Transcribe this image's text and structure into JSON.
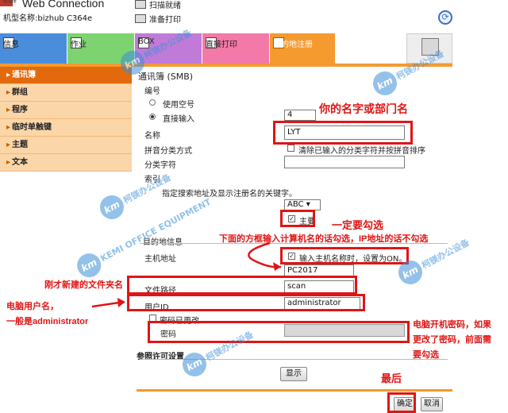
{
  "header": {
    "logo_text": "SCOPE",
    "title": "Web Connection",
    "model_name": "机型名称:bizhub C364e",
    "status_scan": "扫描就绪",
    "status_print": "准备打印"
  },
  "tabs": [
    {
      "label": "信息"
    },
    {
      "label": "作业"
    },
    {
      "label": "BOX"
    },
    {
      "label": "直接打印"
    },
    {
      "label": "目的地注册"
    }
  ],
  "sidebar": {
    "items": [
      {
        "label": "通讯簿"
      },
      {
        "label": "群组"
      },
      {
        "label": "程序"
      },
      {
        "label": "临时单触键"
      },
      {
        "label": "主题"
      },
      {
        "label": "文本"
      }
    ]
  },
  "form": {
    "heading": "通讯簿 (SMB)",
    "number_label": "编号",
    "use_free_number": "使用空号",
    "direct_input": "直接输入",
    "number_value": "4",
    "name_label": "名称",
    "name_value": "LYT",
    "pinyin_label": "拼音分类方式",
    "pinyin_option": "清除已输入的分类字符并按拼音排序",
    "category_label": "分类字符",
    "index_label": "索引",
    "index_hint": "指定搜索地址及显示注册名的关键字。",
    "index_select": "ABC",
    "main_label": "主要",
    "dest_info_label": "目的地信息",
    "host_label": "主机地址",
    "host_option": "输入主机名称时，设置为ON。",
    "host_value": "PC2017",
    "path_label": "文件路径",
    "path_value": "scan",
    "user_label": "用户ID",
    "user_value": "administrator",
    "password_changed_label": "密码已更改",
    "password_label": "密码",
    "ref_label": "参照许可设置",
    "show_button": "显示",
    "ok_button": "确定",
    "cancel_button": "取消"
  },
  "annotations": {
    "name_note": "你的名字或部门名",
    "main_note": "一定要勾选",
    "host_note": "下面的方框输入计算机名的话勾选，IP地址的话不勾选",
    "folder_note": "刚才新建的文件夹名",
    "user_note_1": "电脑用户名，",
    "user_note_2": "一般是administrator",
    "password_note_1": "电脑开机密码，如果",
    "password_note_2": "更改了密码，前面需",
    "password_note_3": "要勾选",
    "last_note": "最后"
  },
  "watermark": {
    "mark": "km",
    "text": "柯镁办公设备",
    "subtext": "KEMI OFFICE EQUIPMENT"
  },
  "colors": {
    "accent_orange": "#f59a2f",
    "sidebar_active": "#e26a0c",
    "annotation_red": "#e01515",
    "watermark_blue": "#3b8fd9"
  }
}
